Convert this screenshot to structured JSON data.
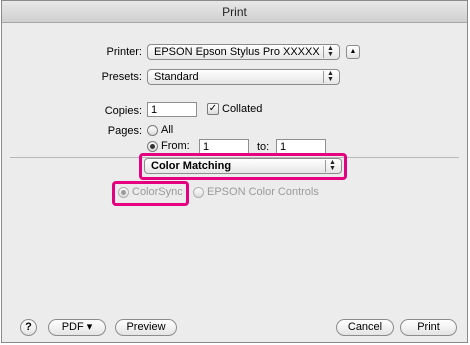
{
  "window": {
    "title": "Print"
  },
  "printer": {
    "label": "Printer:",
    "value": "EPSON Epson Stylus Pro XXXXX"
  },
  "presets": {
    "label": "Presets:",
    "value": "Standard"
  },
  "copies": {
    "label": "Copies:",
    "value": "1",
    "collated_label": "Collated",
    "collated_checked": true
  },
  "pages": {
    "label": "Pages:",
    "all_label": "All",
    "from_label": "From:",
    "from_value": "1",
    "to_label": "to:",
    "to_value": "1",
    "selected": "from"
  },
  "panel": {
    "value": "Color Matching"
  },
  "color_options": {
    "colorsync_label": "ColorSync",
    "epson_label": "EPSON Color Controls",
    "selected": "colorsync"
  },
  "footer": {
    "help_label": "?",
    "pdf_label": "PDF ▾",
    "preview_label": "Preview",
    "cancel_label": "Cancel",
    "print_label": "Print"
  },
  "colors": {
    "highlight": "#e4007f",
    "dialog_bg": "#ececec"
  },
  "icons": {
    "popup_arrows": "up-down-arrows-icon",
    "disclosure": "disclosure-triangle-icon",
    "help": "question-mark-icon"
  }
}
